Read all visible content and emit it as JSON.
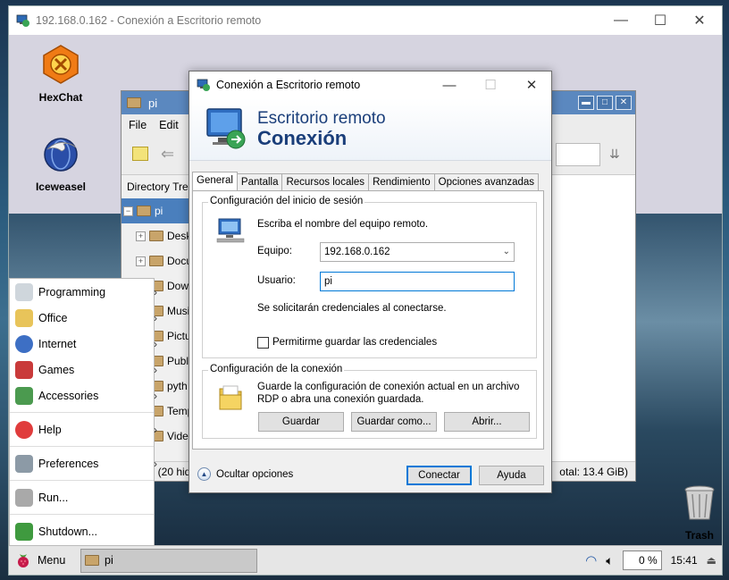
{
  "outer_window": {
    "title": "192.168.0.162 - Conexión a Escritorio remoto",
    "minimize": "—",
    "maximize": "☐",
    "close": "✕"
  },
  "desktop": {
    "icons": [
      {
        "label": "HexChat"
      },
      {
        "label": "Iceweasel"
      },
      {
        "label": "Trash"
      }
    ]
  },
  "file_manager": {
    "title": "pi",
    "menu": [
      "File",
      "Edit",
      "V"
    ],
    "sidebar_header": "Directory Tree",
    "tree": [
      "pi",
      "Desk",
      "Docu",
      "Dowr",
      "Musi",
      "Pictu",
      "Publ",
      "pyth",
      "Temp",
      "Vide"
    ],
    "status_left": ": (20 hid",
    "status_right": "otal: 13.4 GiB)"
  },
  "start_menu": {
    "items": [
      {
        "label": "Programming",
        "submenu": true
      },
      {
        "label": "Office",
        "submenu": true
      },
      {
        "label": "Internet",
        "submenu": true
      },
      {
        "label": "Games",
        "submenu": true
      },
      {
        "label": "Accessories",
        "submenu": true
      },
      {
        "label": "Help",
        "submenu": true
      },
      {
        "label": "Preferences",
        "submenu": true
      },
      {
        "label": "Run...",
        "submenu": false
      },
      {
        "label": "Shutdown...",
        "submenu": false
      }
    ]
  },
  "taskbar": {
    "menu_label": "Menu",
    "task_label": "pi",
    "cpu": "0 %",
    "time": "15:41"
  },
  "dialog": {
    "title": "Conexión a Escritorio remoto",
    "banner_line1": "Escritorio remoto",
    "banner_line2": "Conexión",
    "tabs": [
      "General",
      "Pantalla",
      "Recursos locales",
      "Rendimiento",
      "Opciones avanzadas"
    ],
    "active_tab": "General",
    "login_group": {
      "legend": "Configuración del inicio de sesión",
      "prompt": "Escriba el nombre del equipo remoto.",
      "computer_label": "Equipo:",
      "computer_value": "192.168.0.162",
      "user_label": "Usuario:",
      "user_value": "pi",
      "credentials_note": "Se solicitarán credenciales al conectarse.",
      "save_credentials_label": "Permitirme guardar las credenciales",
      "save_credentials_checked": false
    },
    "connection_group": {
      "legend": "Configuración de la conexión",
      "description_line1": "Guarde la configuración de conexión actual en un archivo",
      "description_line2": "RDP o abra una conexión guardada.",
      "save_button": "Guardar",
      "save_as_button": "Guardar como...",
      "open_button": "Abrir..."
    },
    "hide_options": "Ocultar opciones",
    "connect_button": "Conectar",
    "help_button": "Ayuda"
  }
}
